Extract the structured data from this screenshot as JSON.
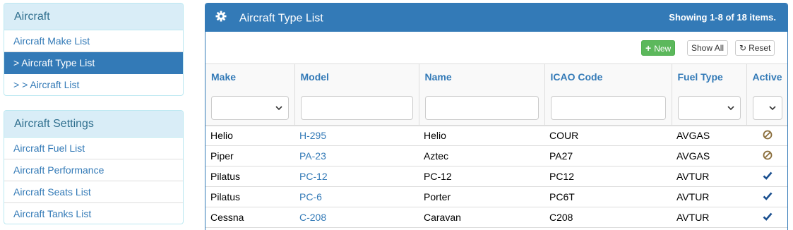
{
  "sidebar": {
    "aircraft": {
      "title": "Aircraft",
      "items": [
        {
          "label": "Aircraft Make List",
          "active": false
        },
        {
          "label": "> Aircraft Type List",
          "active": true
        },
        {
          "label": "> > Aircraft List",
          "active": false
        }
      ]
    },
    "settings": {
      "title": "Aircraft Settings",
      "items": [
        {
          "label": "Aircraft Fuel List"
        },
        {
          "label": "Aircraft Performance"
        },
        {
          "label": "Aircraft Seats List"
        },
        {
          "label": "Aircraft Tanks List"
        }
      ]
    }
  },
  "main": {
    "title": "Aircraft Type List",
    "summary": "Showing 1-8 of 18 items.",
    "toolbar": {
      "new_label": "New",
      "show_all_label": "Show All",
      "reset_label": "Reset"
    },
    "columns": [
      "Make",
      "Model",
      "Name",
      "ICAO Code",
      "Fuel Type",
      "Active"
    ],
    "rows": [
      {
        "make": "Helio",
        "model": "H-295",
        "name": "Helio",
        "icao": "COUR",
        "fuel": "AVGAS",
        "active": false
      },
      {
        "make": "Piper",
        "model": "PA-23",
        "name": "Aztec",
        "icao": "PA27",
        "fuel": "AVGAS",
        "active": false
      },
      {
        "make": "Pilatus",
        "model": "PC-12",
        "name": "PC-12",
        "icao": "PC12",
        "fuel": "AVTUR",
        "active": true
      },
      {
        "make": "Pilatus",
        "model": "PC-6",
        "name": "Porter",
        "icao": "PC6T",
        "fuel": "AVTUR",
        "active": true
      },
      {
        "make": "Cessna",
        "model": "C-208",
        "name": "Caravan",
        "icao": "C208",
        "fuel": "AVTUR",
        "active": true
      }
    ]
  },
  "colors": {
    "primary": "#337ab7",
    "success": "#5cb85c",
    "inactive_icon": "#8a6d3b",
    "active_icon": "#1a4f8f"
  },
  "icons": {
    "header": "gear-icon",
    "new": "plus-icon",
    "reset": "refresh-icon",
    "active_true": "check-icon",
    "active_false": "ban-icon"
  }
}
